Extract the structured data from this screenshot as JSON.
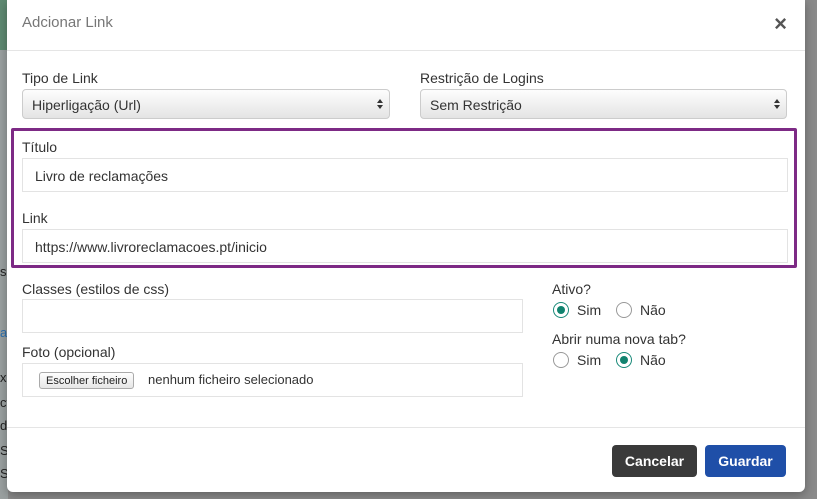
{
  "modal": {
    "title": "Adcionar Link",
    "close_glyph": "×"
  },
  "form": {
    "link_type": {
      "label": "Tipo de Link",
      "value": "Hiperligação (Url)"
    },
    "login_restriction": {
      "label": "Restrição de Logins",
      "value": "Sem Restrição"
    },
    "title_field": {
      "label": "Título",
      "value": "Livro de reclamações"
    },
    "link_field": {
      "label": "Link",
      "value": "https://www.livroreclamacoes.pt/inicio"
    },
    "classes_field": {
      "label": "Classes (estilos de css)",
      "value": ""
    },
    "photo_field": {
      "label": "Foto (opcional)",
      "button_label": "Escolher ficheiro",
      "status": "nenhum ficheiro selecionado"
    },
    "active": {
      "label": "Ativo?",
      "options": [
        {
          "label": "Sim",
          "checked": true
        },
        {
          "label": "Não",
          "checked": false
        }
      ]
    },
    "new_tab": {
      "label": "Abrir numa nova tab?",
      "options": [
        {
          "label": "Sim",
          "checked": false
        },
        {
          "label": "Não",
          "checked": true
        }
      ]
    }
  },
  "footer": {
    "cancel_label": "Cancelar",
    "save_label": "Guardar"
  },
  "background": {
    "chars": [
      "s",
      "a",
      "x",
      "ct",
      "d",
      "S",
      "S"
    ]
  },
  "colors": {
    "highlight": "#7d2a85",
    "radio_checked": "#11836f",
    "save_button": "#1f4fa8",
    "cancel_button": "#3a3a3a"
  }
}
